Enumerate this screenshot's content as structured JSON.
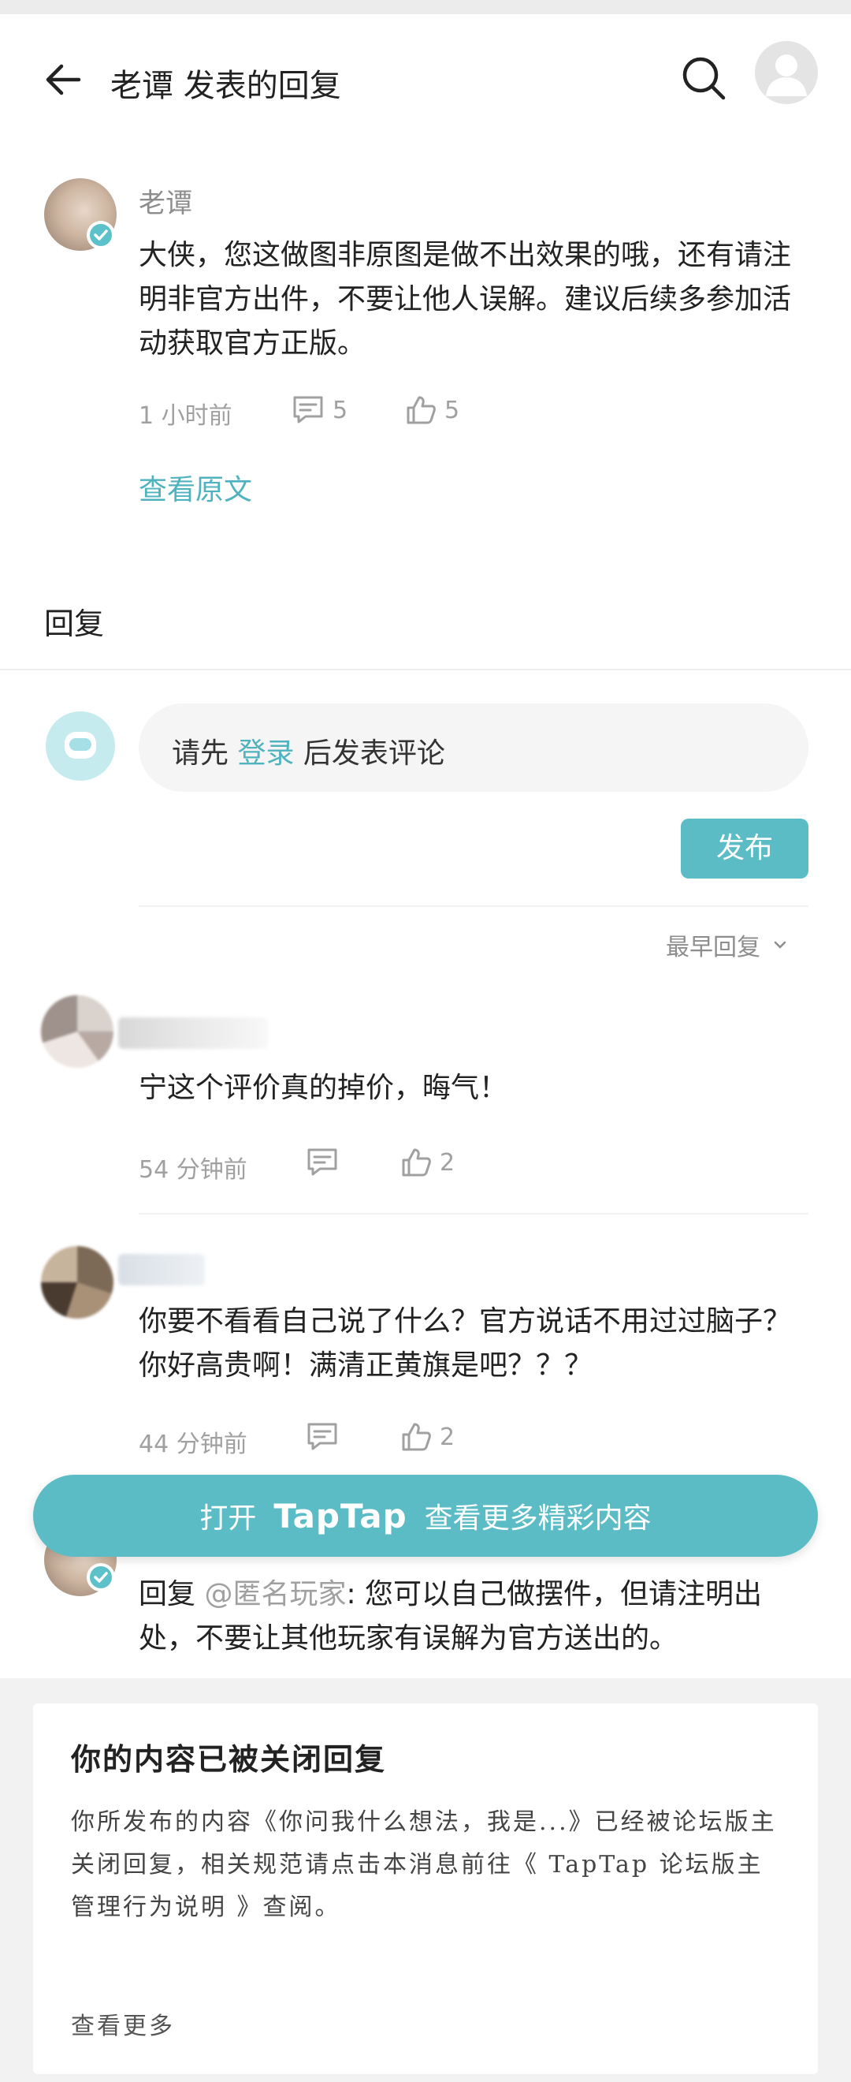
{
  "header": {
    "title": "老谭 发表的回复"
  },
  "main_comment": {
    "author": "老谭",
    "text": "大侠，您这做图非原图是做不出效果的哦，还有请注明非官方出件，不要让他人误解。建议后续多参加活动获取官方正版。",
    "time": "1 小时前",
    "comment_count": "5",
    "like_count": "5",
    "view_original": "查看原文"
  },
  "replies_section": {
    "heading": "回复",
    "login_prefix": "请先 ",
    "login_link": "登录",
    "login_suffix": " 后发表评论",
    "publish_label": "发布",
    "sort_label": "最早回复"
  },
  "replies": [
    {
      "text": "宁这个评价真的掉价，晦气！",
      "time": "54 分钟前",
      "like_count": "2"
    },
    {
      "text": "你要不看看自己说了什么？官方说话不用过过脑子？你好高贵啊！满清正黄旗是吧？？？",
      "time": "44 分钟前",
      "like_count": "2"
    }
  ],
  "open_banner": {
    "prefix": "打开",
    "brand": "TapTap",
    "suffix": "查看更多精彩内容"
  },
  "host_reply": {
    "prefix": "回复 ",
    "mention": "@匿名玩家",
    "text": ": 您可以自己做摆件，但请注明出处，不要让其他玩家有误解为官方送出的。"
  },
  "notice": {
    "title": "你的内容已被关闭回复",
    "body": "你所发布的内容《你问我什么想法，我是...》已经被论坛版主关闭回复，相关规范请点击本消息前往《 TapTap 论坛版主管理行为说明 》查阅。",
    "more": "查看更多"
  },
  "colors": {
    "accent": "#5bbcc6",
    "link": "#4fb3bf",
    "muted": "#a0a0a0"
  },
  "icons": [
    "back-arrow-icon",
    "search-icon",
    "user-avatar-icon",
    "verified-badge-icon",
    "comment-icon",
    "thumbs-up-icon",
    "chevron-down-icon"
  ]
}
